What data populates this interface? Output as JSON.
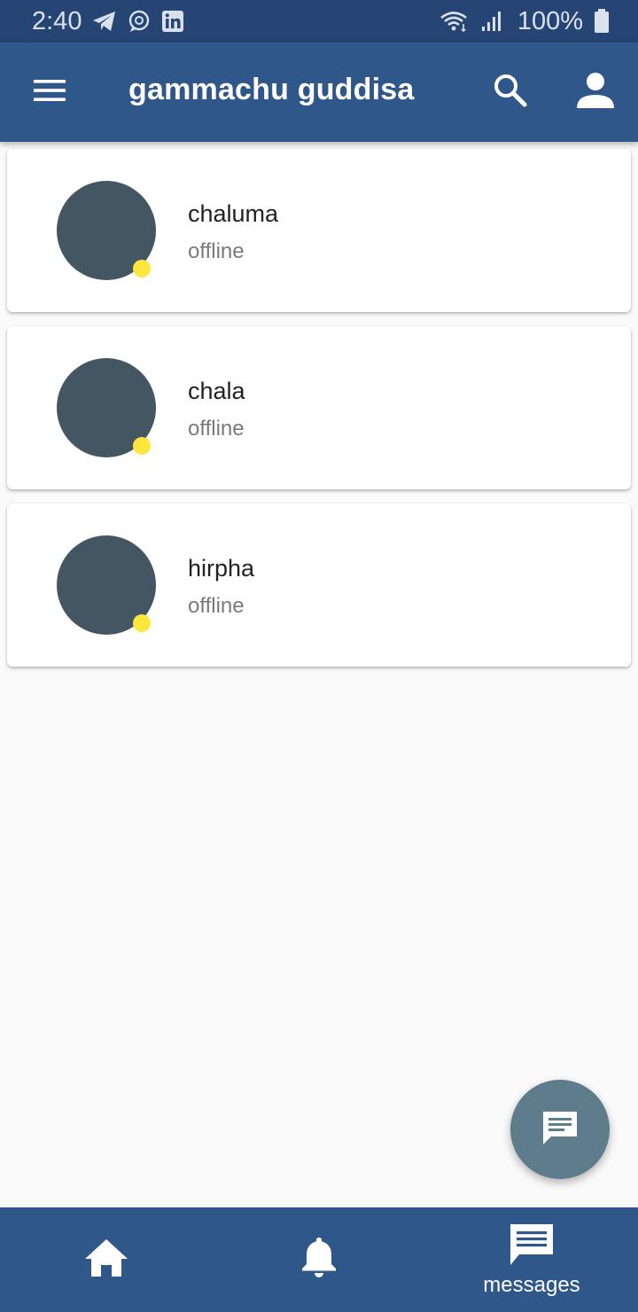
{
  "status_bar": {
    "time": "2:40",
    "battery": "100%",
    "left_icons": [
      "telegram-icon",
      "signal-app-icon",
      "linkedin-icon"
    ],
    "right_icons": [
      "wifi-icon",
      "cell-signal-icon",
      "battery-icon"
    ]
  },
  "app_bar": {
    "title": "gammachu guddisa",
    "color": "#2f5789"
  },
  "contacts": [
    {
      "name": "chaluma",
      "status": "offline"
    },
    {
      "name": "chala",
      "status": "offline"
    },
    {
      "name": "hirpha",
      "status": "offline"
    }
  ],
  "colors": {
    "avatar": "#455663",
    "presence_dot": "#fde73f",
    "fab": "#5f7c8c"
  },
  "bottom_nav": {
    "items": [
      {
        "icon": "home-icon",
        "label": ""
      },
      {
        "icon": "bell-icon",
        "label": ""
      },
      {
        "icon": "message-icon",
        "label": "messages"
      }
    ]
  }
}
